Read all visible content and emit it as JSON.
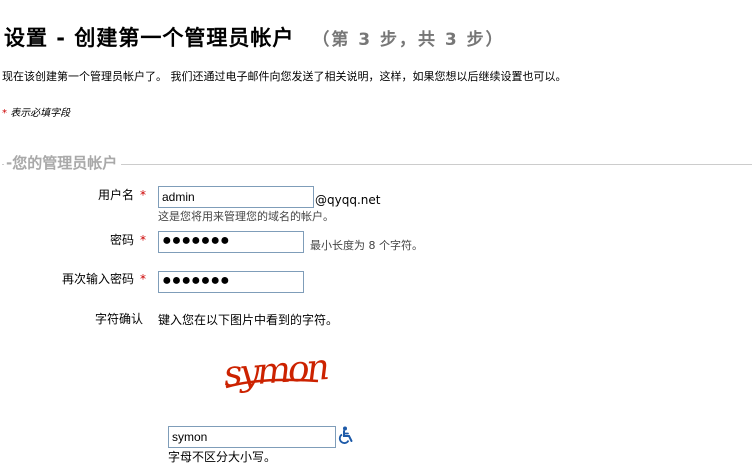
{
  "header": {
    "title": "设置 - 创建第一个管理员帐户",
    "step": "（第 3 步，共 3 步）"
  },
  "intro": "现在该创建第一个管理员帐户了。 我们还通过电子邮件向您发送了相关说明，这样，如果您想以后继续设置也可以。",
  "required_note": {
    "star": "*",
    "text": "表示必填字段"
  },
  "fieldset": {
    "legend": "您的管理员帐户"
  },
  "form": {
    "username": {
      "label": "用户名",
      "star": "*",
      "value": "admin",
      "domain": "@qyqq.net",
      "hint": "这是您将用来管理您的域名的帐户。"
    },
    "password": {
      "label": "密码",
      "star": "*",
      "value": "●●●●●●●",
      "hint": "最小长度为 8 个字符。"
    },
    "password_confirm": {
      "label": "再次输入密码",
      "star": "*",
      "value": "●●●●●●●"
    },
    "captcha": {
      "label": "字符确认",
      "instruction": "键入您在以下图片中看到的字符。",
      "image_text": "symon",
      "value": "symon",
      "hint": "字母不区分大小写。",
      "accessibility_icon": "wheelchair-icon"
    }
  },
  "colors": {
    "required_star": "#cc0000",
    "legend": "#a9a9a9",
    "captcha_text": "#cc2200",
    "accessibility_icon": "#1d5aa8"
  }
}
